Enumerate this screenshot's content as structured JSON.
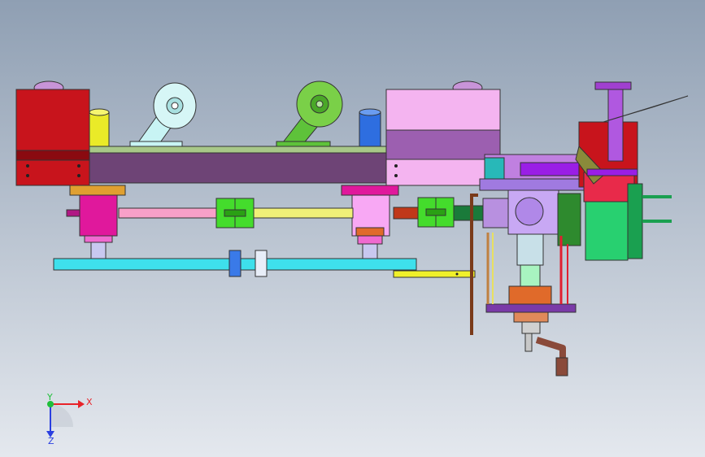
{
  "viewport": {
    "background_top": "#8f9fb3",
    "background_bottom": "#e4e8ee"
  },
  "triad": {
    "x_label": "X",
    "y_label": "Y",
    "z_label": "Z",
    "x_color": "#e8232a",
    "y_color": "#1fbf3a",
    "z_color": "#2a3fe0"
  },
  "palette": {
    "red": "#c8141c",
    "purple_frame": "#6e4476",
    "frame_top": "#a8c888",
    "pink_block": "#f4b4f0",
    "pink_block_band": "#9c5fb0",
    "cyan_plate": "#3ee0ec",
    "yellow": "#f0f02a",
    "magenta": "#e0189c",
    "green": "#44dc2c",
    "lavender": "#a07ae0",
    "orange": "#e06a2a",
    "teal": "#28b8b8",
    "violet": "#9a1ee6",
    "brown": "#8a4a3a"
  }
}
